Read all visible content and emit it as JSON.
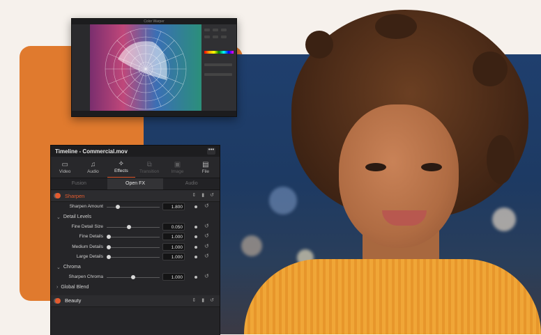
{
  "warper": {
    "title": "Color Warper"
  },
  "inspector": {
    "title": "Timeline - Commercial.mov",
    "more_label": "•••",
    "tabs": [
      {
        "label": "Video",
        "icon": "▭",
        "state": "normal"
      },
      {
        "label": "Audio",
        "icon": "♫",
        "state": "normal"
      },
      {
        "label": "Effects",
        "icon": "✧",
        "state": "active"
      },
      {
        "label": "Transition",
        "icon": "⧉",
        "state": "disabled"
      },
      {
        "label": "Image",
        "icon": "▣",
        "state": "disabled"
      },
      {
        "label": "File",
        "icon": "▤",
        "state": "normal"
      }
    ],
    "subtabs": [
      {
        "label": "Fusion",
        "active": false
      },
      {
        "label": "Open FX",
        "active": true
      },
      {
        "label": "Audio",
        "active": false
      }
    ],
    "sharpen": {
      "label": "Sharpen",
      "amount_label": "Sharpen Amount",
      "amount_value": "1.800",
      "amount_level": 0.18
    },
    "detail_levels": {
      "label": "Detail Levels",
      "rows": [
        {
          "label": "Fine Detail Size",
          "value": "0.050",
          "level": 0.42
        },
        {
          "label": "Fine Details",
          "value": "1.000",
          "level": 0.0
        },
        {
          "label": "Medium Details",
          "value": "1.000",
          "level": 0.0
        },
        {
          "label": "Large Details",
          "value": "1.000",
          "level": 0.0
        }
      ]
    },
    "chroma": {
      "label": "Chroma",
      "row_label": "Sharpen Chroma",
      "row_value": "1.000",
      "row_level": 0.5
    },
    "global_blend": {
      "label": "Global Blend"
    },
    "beauty": {
      "label": "Beauty"
    }
  },
  "colors": {
    "accent": "#e45b2f",
    "brand_orange": "#e07a2e"
  }
}
